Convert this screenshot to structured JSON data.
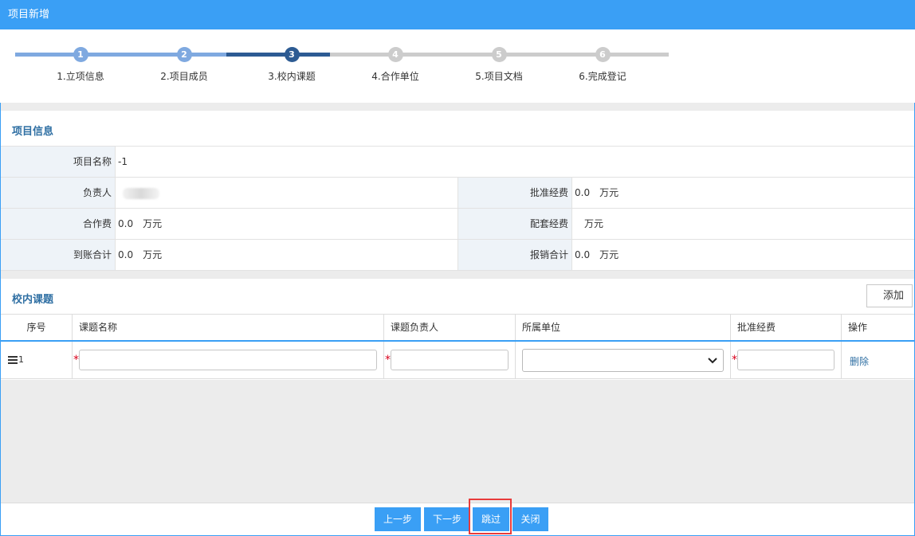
{
  "window": {
    "title": "项目新增"
  },
  "stepper": {
    "steps": [
      {
        "number": "1",
        "label": "1.立项信息",
        "state": "done"
      },
      {
        "number": "2",
        "label": "2.项目成员",
        "state": "done"
      },
      {
        "number": "3",
        "label": "3.校内课题",
        "state": "current"
      },
      {
        "number": "4",
        "label": "4.合作单位",
        "state": "todo"
      },
      {
        "number": "5",
        "label": "5.项目文档",
        "state": "todo"
      },
      {
        "number": "6",
        "label": "6.完成登记",
        "state": "todo"
      }
    ],
    "colors": {
      "done": "#7fa9e0",
      "current": "#2d5b93",
      "todo": "#cccccc"
    }
  },
  "project_info": {
    "section_title": "项目信息",
    "name_label": "项目名称",
    "name_value": "-1",
    "leader_label": "负责人",
    "approved_label": "批准经费",
    "approved_value": "0.0",
    "coop_label": "合作费",
    "coop_value": "0.0",
    "matching_label": "配套经费",
    "matching_value": "",
    "received_label": "到账合计",
    "received_value": "0.0",
    "reimbursed_label": "报销合计",
    "reimbursed_value": "0.0",
    "unit": "万元"
  },
  "subjects": {
    "section_title": "校内课题",
    "add_label": "添加",
    "columns": [
      "序号",
      "课题名称",
      "课题负责人",
      "所属单位",
      "批准经费",
      "操作"
    ],
    "rows": [
      {
        "index": "1",
        "name": "",
        "leader": "",
        "unit": "",
        "funds": "",
        "action": "删除"
      }
    ]
  },
  "footer": {
    "prev_label": "上一步",
    "next_label": "下一步",
    "skip_label": "跳过",
    "close_label": "关闭"
  },
  "accent": "#3a9ff5",
  "highlight_color": "#e83b3b"
}
